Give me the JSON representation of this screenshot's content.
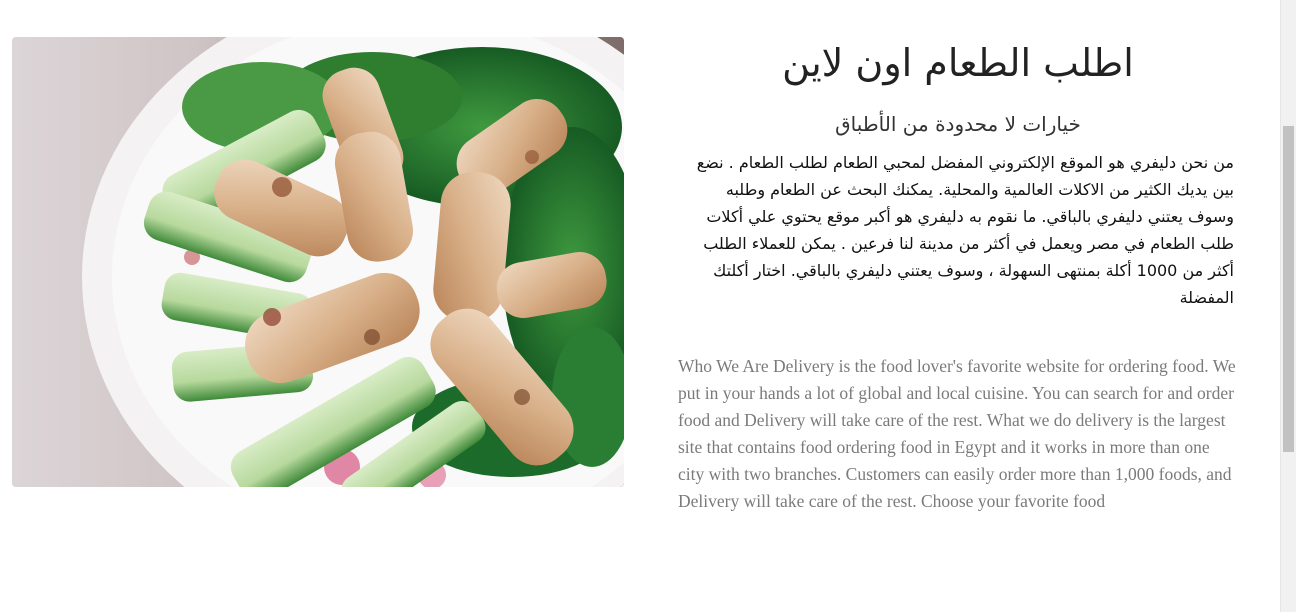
{
  "hero": {
    "image_label": "spring-rolls-photo"
  },
  "content": {
    "title_ar": "اطلب الطعام اون لاين",
    "subtitle_ar": "خيارات لا محدودة من الأطباق",
    "about_ar": "من نحن دليفري هو الموقع الإلكتروني المفضل لمحبي الطعام لطلب الطعام . نضع بين يديك الكثير من الاكلات العالمية والمحلية. يمكنك البحث عن الطعام وطلبه وسوف يعتني دليفري بالباقي. ما نقوم به دليفري هو أكبر موقع يحتوي علي أكلات طلب الطعام في مصر ويعمل في أكثر من مدينة لنا فرعين . يمكن للعملاء الطلب أكثر من 1000 أكلة بمنتهى السهولة ، وسوف يعتني دليفري بالباقي. اختار أكلتك المفضلة",
    "about_en": "Who We Are Delivery is the food lover's favorite website for ordering food. We put in your hands a lot of global and local cuisine. You can search for and order food and Delivery will take care of the rest. What we do delivery is the largest site that contains food ordering food in Egypt and it works in more than one city with two branches. Customers can easily order more than 1,000 foods, and Delivery will take care of the rest. Choose your favorite food"
  },
  "colors": {
    "title": "#222222",
    "body_ar": "#111111",
    "body_en": "#7a7a7a",
    "scrollbar_track": "#f1f1f1",
    "scrollbar_thumb": "#c1c1c1"
  }
}
